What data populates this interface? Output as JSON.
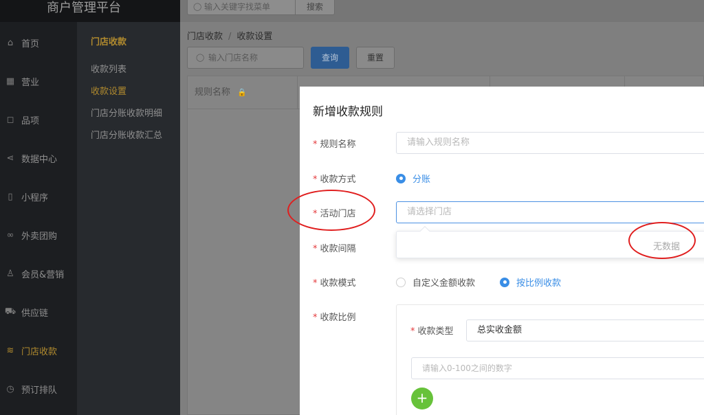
{
  "brand": {
    "title": "商户管理平台"
  },
  "top": {
    "search_placeholder": "输入关键字找菜单",
    "search_button": "搜索"
  },
  "nav": {
    "items": [
      {
        "label": "首页",
        "icon": "home-icon"
      },
      {
        "label": "营业",
        "icon": "calendar-icon"
      },
      {
        "label": "品项",
        "icon": "bag-icon"
      },
      {
        "label": "数据中心",
        "icon": "share-icon"
      },
      {
        "label": "小程序",
        "icon": "phone-icon"
      },
      {
        "label": "外卖团购",
        "icon": "bike-icon"
      },
      {
        "label": "会员&营销",
        "icon": "user-icon"
      },
      {
        "label": "供应链",
        "icon": "truck-icon"
      },
      {
        "label": "门店收款",
        "icon": "coins-icon"
      },
      {
        "label": "预订排队",
        "icon": "clock-icon"
      }
    ],
    "active": "门店收款"
  },
  "subnav": {
    "title": "门店收款",
    "items": [
      "收款列表",
      "收款设置",
      "门店分账收款明细",
      "门店分账收款汇总"
    ],
    "active": "收款设置"
  },
  "content": {
    "breadcrumb": [
      "门店收款",
      "收款设置"
    ],
    "filter_placeholder": "输入门店名称",
    "query_button": "查询",
    "reset_button": "重置",
    "table_headers": [
      "规则名称"
    ]
  },
  "modal": {
    "title": "新增收款规则",
    "rule_name": {
      "label": "规则名称",
      "placeholder": "请输入规则名称"
    },
    "pay_method": {
      "label": "收款方式",
      "option": "分账"
    },
    "store": {
      "label": "活动门店",
      "placeholder": "请选择门店",
      "empty_text": "无数据"
    },
    "interval": {
      "label": "收款间隔"
    },
    "mode": {
      "label": "收款模式",
      "options": [
        "自定义金额收款",
        "按比例收款"
      ],
      "selected": "按比例收款"
    },
    "ratio": {
      "label": "收款比例",
      "type_label": "收款类型",
      "type_value": "总实收金额",
      "number_placeholder": "请输入0-100之间的数字",
      "add_symbol": "+"
    }
  },
  "colors": {
    "accent": "#b08a2e",
    "primary": "#3a8ee6",
    "annotation": "#e01e1e",
    "add_button": "#67c23a"
  }
}
